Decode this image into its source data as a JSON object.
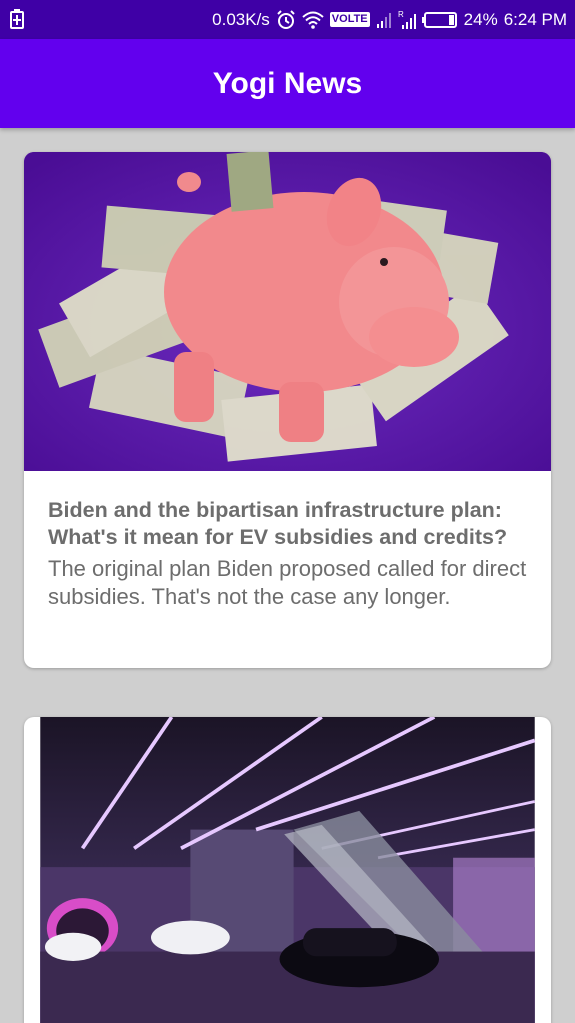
{
  "status_bar": {
    "network_speed": "0.03K/s",
    "volte_label": "VOLTE",
    "battery_percent": "24%",
    "time": "6:24 PM",
    "icons": [
      "battery-charging-icon",
      "alarm-icon",
      "wifi-icon",
      "volte-icon",
      "signal-icon",
      "signal-roaming-icon",
      "battery-icon"
    ]
  },
  "app_bar": {
    "title": "Yogi News"
  },
  "articles": [
    {
      "title": "Biden and the bipartisan infrastructure plan: What's it mean for EV subsidies and credits?",
      "description": "The original plan Biden proposed called for direct subsidies. That's not the case any longer.",
      "image": "piggy-bank-with-dollar-bills"
    },
    {
      "title": "",
      "description": "",
      "image": "tunnel-station-with-cars-and-neon-lights"
    }
  ],
  "colors": {
    "status_bar": "#3f00a6",
    "app_bar": "#6200ee",
    "background": "#cfcfcf",
    "card_text": "#6d6d6d"
  }
}
